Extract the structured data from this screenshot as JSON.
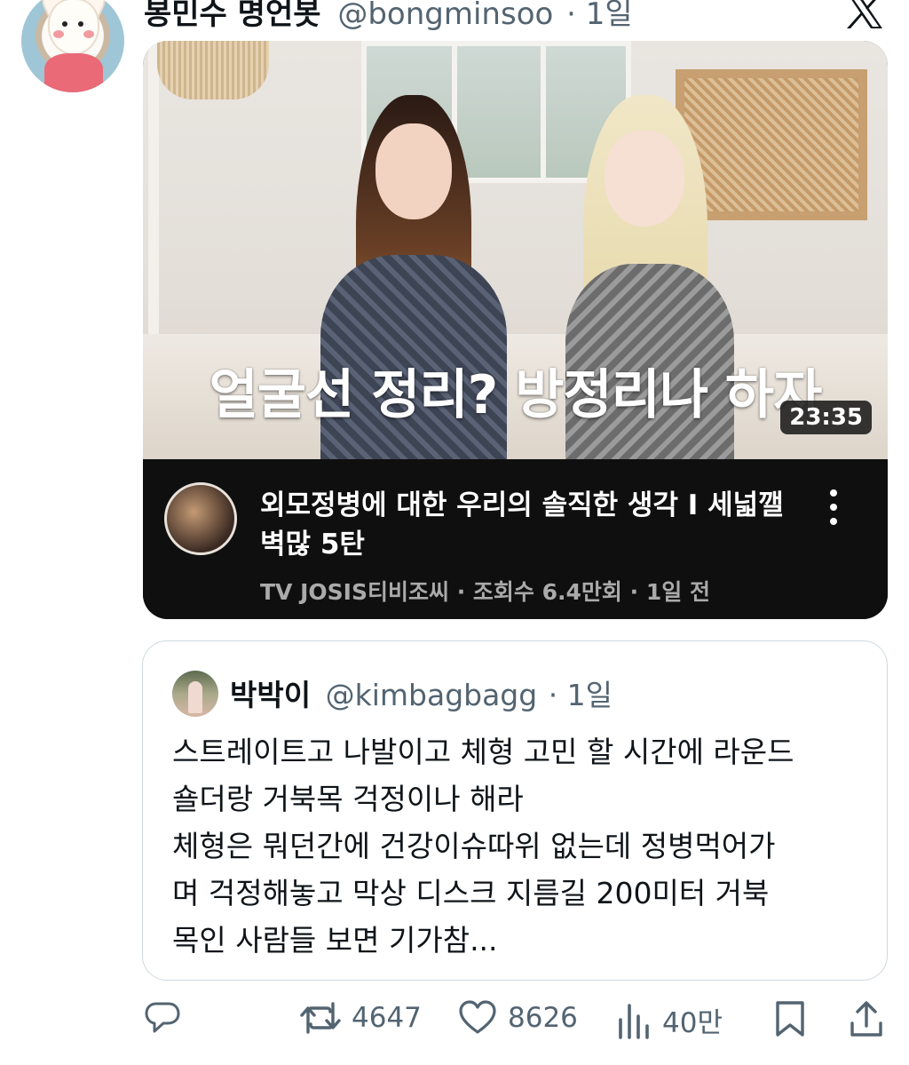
{
  "tweet": {
    "author_name": "봉민수 명언봇",
    "author_handle": "@bongminsoo",
    "time": "· 1일"
  },
  "video": {
    "thumbnail_caption": "얼굴선 정리? 방정리나 하자",
    "duration": "23:35",
    "title": "외모정병에 대한 우리의 솔직한 생각 I 세넓깰벽많 5탄",
    "channel": "TV JOSIS티비조씨",
    "views": "조회수 6.4만회",
    "age": "1일 전",
    "meta_separator": "·"
  },
  "quote": {
    "author_name": "박박이",
    "author_handle": "@kimbagbagg",
    "time": "· 1일",
    "text": "스트레이트고 나발이고 체형 고민 할 시간에 라운드\n숄더랑 거북목 걱정이나 해라\n체형은 뭐던간에 건강이슈따위 없는데 정병먹어가\n며 걱정해놓고 막상 디스크 지름길 200미터 거북\n목인 사람들 보면 기가참..."
  },
  "actions": {
    "retweets": "4647",
    "likes": "8626",
    "views": "40만"
  },
  "colors": {
    "text_primary": "#0f1419",
    "text_secondary": "#536471",
    "border": "#cfd9de",
    "video_bg": "#0f0f0f"
  },
  "icons": [
    "x-logo-icon",
    "kebab-menu-icon",
    "reply-icon",
    "retweet-icon",
    "like-icon",
    "views-icon",
    "bookmark-icon",
    "share-icon"
  ]
}
